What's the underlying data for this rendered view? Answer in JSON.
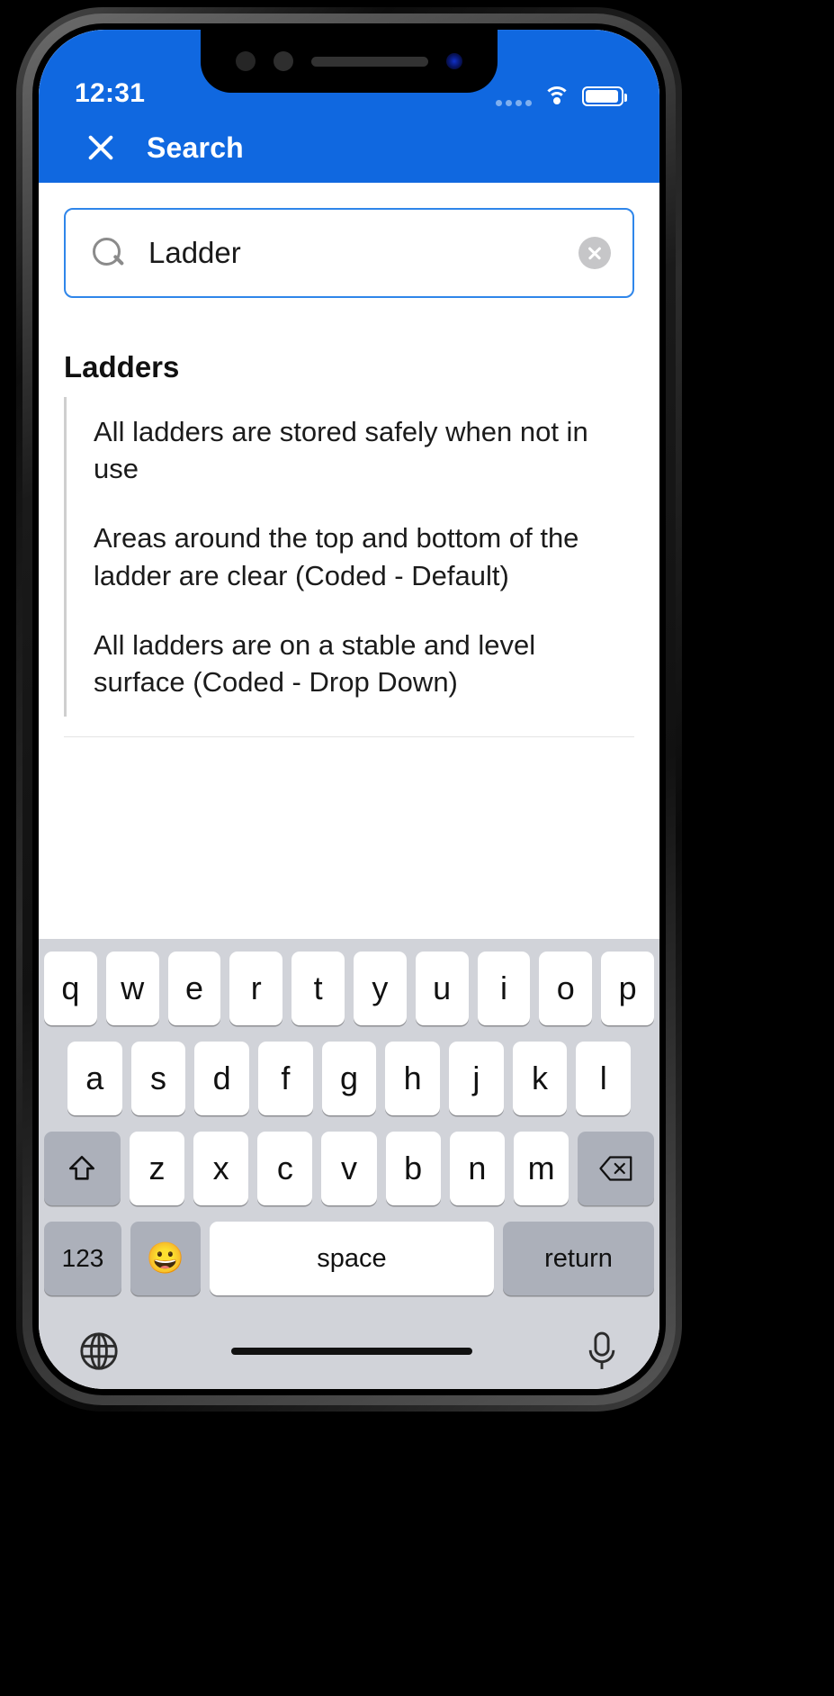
{
  "statusbar": {
    "time": "12:31",
    "signal_icon": "signal-dots-icon",
    "wifi_icon": "wifi-icon",
    "battery_icon": "battery-icon"
  },
  "appbar": {
    "close_icon": "close-icon",
    "title": "Search",
    "background": "#1068E0"
  },
  "search": {
    "icon": "search-icon",
    "value": "Ladder",
    "placeholder": "Search",
    "clear_icon": "clear-icon",
    "border_color": "#2F86EA"
  },
  "results": {
    "section_title": "Ladders",
    "items": [
      {
        "text": "All ladders are stored safely when not in use"
      },
      {
        "text": "Areas around the top and bottom of the ladder are clear (Coded - Default)"
      },
      {
        "text": "All ladders are on a stable and level surface (Coded - Drop Down)"
      }
    ]
  },
  "keyboard": {
    "row1": [
      "q",
      "w",
      "e",
      "r",
      "t",
      "y",
      "u",
      "i",
      "o",
      "p"
    ],
    "row2": [
      "a",
      "s",
      "d",
      "f",
      "g",
      "h",
      "j",
      "k",
      "l"
    ],
    "row3": [
      "z",
      "x",
      "c",
      "v",
      "b",
      "n",
      "m"
    ],
    "shift_label": "shift-icon",
    "backspace_label": "backspace-icon",
    "numbers_label": "123",
    "emoji_label": "😀",
    "space_label": "space",
    "return_label": "return",
    "globe_icon": "globe-icon",
    "mic_icon": "microphone-icon"
  }
}
